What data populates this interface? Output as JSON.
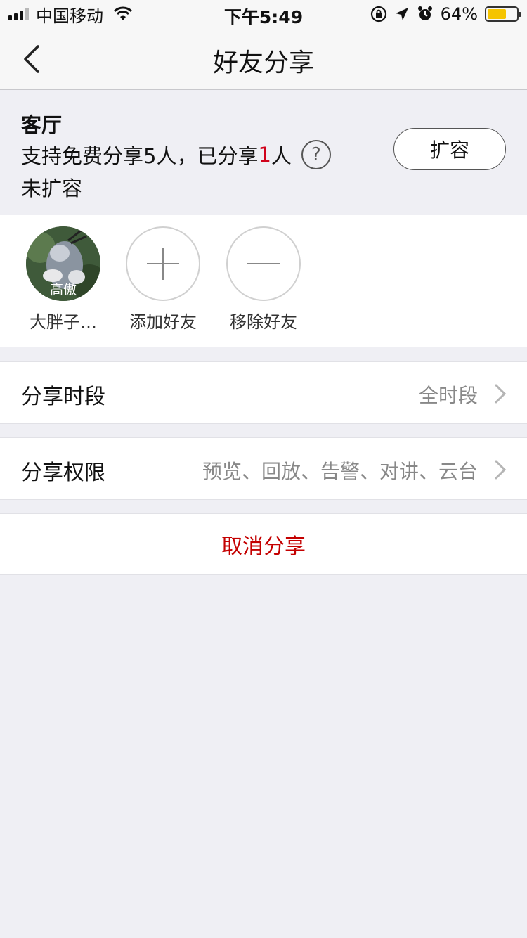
{
  "status_bar": {
    "carrier": "中国移动",
    "time": "下午5:49",
    "battery_percent": "64%",
    "battery_level": 0.64,
    "battery_color": "#f5c400"
  },
  "navbar": {
    "title": "好友分享",
    "back_icon": "chevron-left-icon"
  },
  "info": {
    "room_name": "客厅",
    "quota_prefix": "支持免费分享5人，已分享",
    "quota_count": "1",
    "quota_suffix": "人",
    "expansion_status": "未扩容",
    "expand_button": "扩容",
    "help_icon": "question-circle-icon"
  },
  "friends": {
    "items": [
      {
        "label": "大胖子…",
        "avatar_tag": "高傲",
        "type": "avatar"
      },
      {
        "label": "添加好友",
        "type": "add",
        "icon": "plus-icon"
      },
      {
        "label": "移除好友",
        "type": "remove",
        "icon": "minus-icon"
      }
    ]
  },
  "settings": {
    "period": {
      "label": "分享时段",
      "value": "全时段"
    },
    "permissions": {
      "label": "分享权限",
      "value": "预览、回放、告警、对讲、云台"
    }
  },
  "cancel_label": "取消分享",
  "colors": {
    "accent_red": "#d0021b",
    "cancel_red": "#c40000",
    "background": "#efeff4"
  }
}
